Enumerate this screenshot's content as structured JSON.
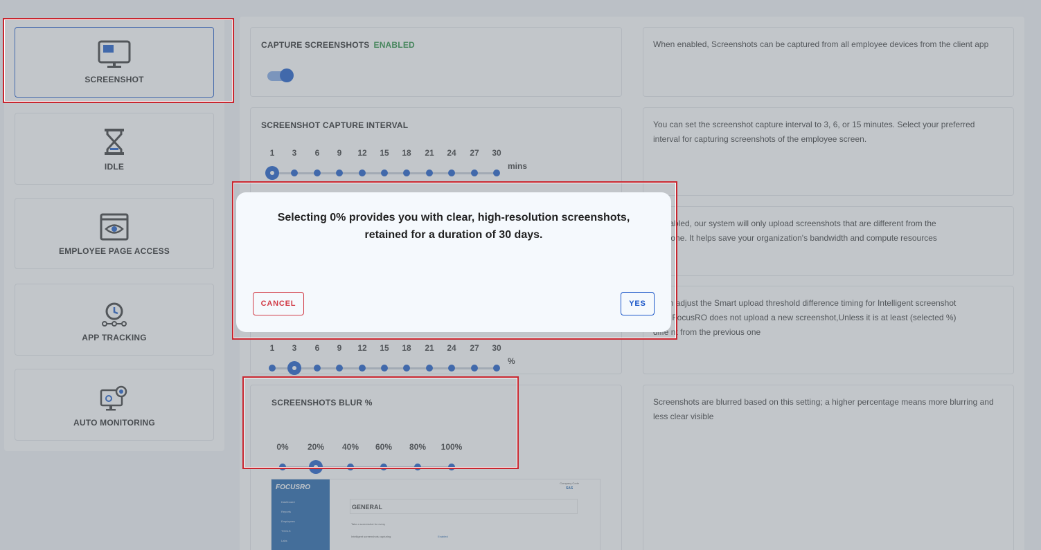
{
  "sidebar": {
    "items": [
      {
        "label": "SCREENSHOT",
        "icon": "monitor-icon",
        "active": true
      },
      {
        "label": "IDLE",
        "icon": "hourglass-icon",
        "active": false
      },
      {
        "label": "EMPLOYEE PAGE ACCESS",
        "icon": "eye-browser-icon",
        "active": false
      },
      {
        "label": "APP TRACKING",
        "icon": "clock-flow-icon",
        "active": false
      },
      {
        "label": "AUTO MONITORING",
        "icon": "gear-monitor-icon",
        "active": false
      }
    ]
  },
  "settings": {
    "capture": {
      "title": "CAPTURE SCREENSHOTS",
      "status": "ENABLED",
      "toggle_on": true,
      "description": "When enabled, Screenshots can be captured from all employee devices from the client app"
    },
    "interval": {
      "title": "SCREENSHOT CAPTURE INTERVAL",
      "ticks": [
        "1",
        "3",
        "6",
        "9",
        "12",
        "15",
        "18",
        "21",
        "24",
        "27",
        "30"
      ],
      "unit": "mins",
      "selected": "1",
      "description": "You can set the screenshot capture interval to 3, 6, or 15 minutes. Select your preferred interval for capturing screenshots of the employee screen."
    },
    "intelligent": {
      "description_visible": "n enabled, our system will only upload screenshots that are different from the",
      "description_visible_2": "ious one. It helps save your organization's bandwidth and compute resources"
    },
    "threshold": {
      "ticks_partial": [
        "1",
        "3",
        "6",
        "9",
        "12",
        "15",
        "18",
        "21",
        "24",
        "27",
        "30"
      ],
      "unit": "%",
      "selected": "3",
      "description_1": "u can adjust the Smart upload threshold difference timing for Intelligent screenshot",
      "description_2": "ure , FocusRO does not upload a new screenshot,Unless it is at least (selected %)",
      "description_3": "diffe   nt from the previous one"
    },
    "blur": {
      "title": "SCREENSHOTS BLUR %",
      "ticks": [
        "0%",
        "20%",
        "40%",
        "60%",
        "80%",
        "100%"
      ],
      "selected": "20%",
      "description": "Screenshots are blurred based on this setting; a higher percentage means more blurring and less clear visible"
    }
  },
  "preview": {
    "logo": "FOCUSRO",
    "menu": [
      "Dashboard",
      "Reports",
      "Employees",
      "TOOLS",
      "Labs"
    ],
    "company_label": "Company Code",
    "company_code": "SAS",
    "section_title": "GENERAL",
    "rows": [
      "Take a screenshot for every",
      "Intelligent screenshots capturing",
      "Enabled"
    ]
  },
  "modal": {
    "message_line1": "Selecting 0% provides you with clear, high-resolution screenshots,",
    "message_line2": "retained for a duration of 30 days.",
    "cancel_label": "CANCEL",
    "yes_label": "YES"
  },
  "colors": {
    "accent": "#1557c7",
    "danger": "#d13a45",
    "enabled": "#1f8a3a"
  }
}
